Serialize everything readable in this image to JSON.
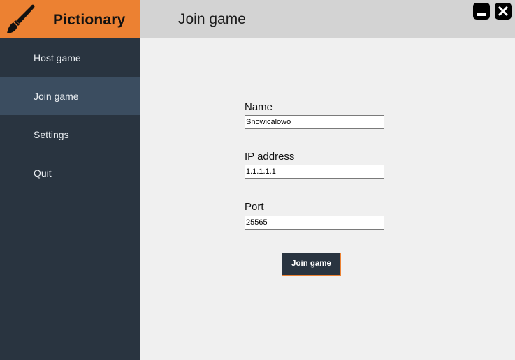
{
  "app": {
    "title": "Pictionary",
    "accent_color": "#ec8132",
    "sidebar_color": "#293440",
    "sidebar_active_color": "#3b4d60"
  },
  "sidebar": {
    "brand_icon": "paintbrush-icon",
    "items": [
      {
        "label": "Host game",
        "active": false
      },
      {
        "label": "Join game",
        "active": true
      },
      {
        "label": "Settings",
        "active": false
      },
      {
        "label": "Quit",
        "active": false
      }
    ]
  },
  "header": {
    "title": "Join game",
    "window_controls": {
      "minimize_icon": "minimize-icon",
      "close_icon": "close-icon"
    }
  },
  "form": {
    "name": {
      "label": "Name",
      "value": "Snowicalowo"
    },
    "ip": {
      "label": "IP address",
      "value": "1.1.1.1.1"
    },
    "port": {
      "label": "Port",
      "value": "25565"
    },
    "submit_label": "Join game"
  }
}
